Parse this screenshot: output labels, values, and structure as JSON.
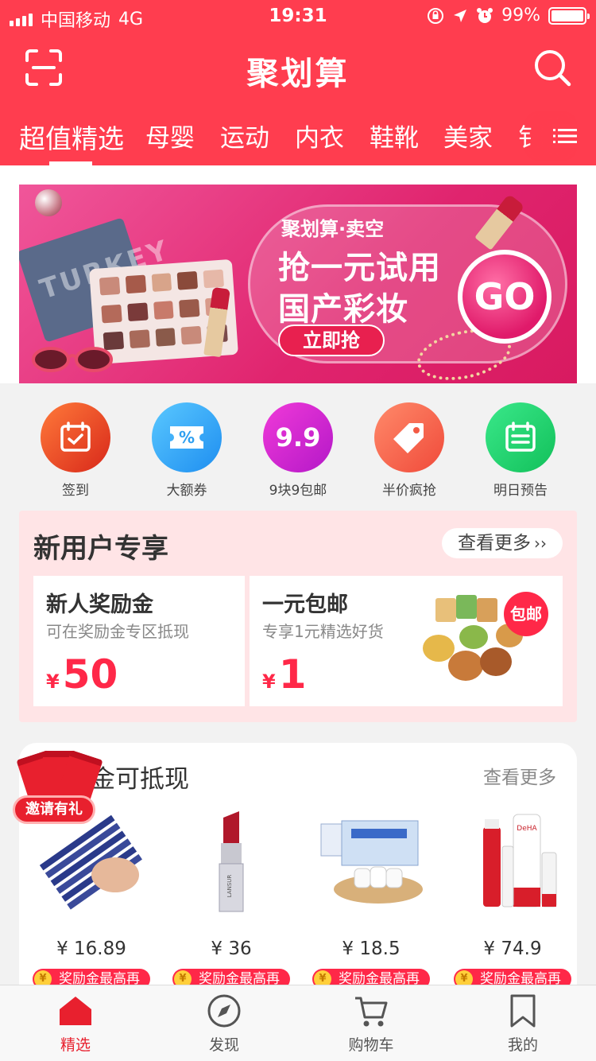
{
  "status_bar": {
    "carrier": "中国移动",
    "network": "4G",
    "time": "19:31",
    "battery": "99%",
    "battery_level": 0.99
  },
  "header": {
    "title": "聚划算",
    "tabs": [
      "超值精选",
      "母婴",
      "运动",
      "内衣",
      "鞋靴",
      "美家",
      "钅"
    ],
    "active_tab": 0,
    "accent": "#ff3d4f"
  },
  "banner": {
    "brand": "聚划算·卖空",
    "headline_line1": "抢一元试用",
    "headline_line2": "国产彩妆",
    "cta": "立即抢",
    "go": "GO",
    "box_text": "TURKEY"
  },
  "quick_entries": [
    {
      "label": "签到",
      "icon": "calendar-check-icon",
      "color": "#e8381f"
    },
    {
      "label": "大额券",
      "icon": "coupon-percent-icon",
      "color": "#2e9ff0"
    },
    {
      "label": "9块9包邮",
      "icon": "nine-nine-icon",
      "color": "#e01fb8",
      "text": "9.9"
    },
    {
      "label": "半价疯抢",
      "icon": "price-tag-icon",
      "color": "#ff6a55"
    },
    {
      "label": "明日预告",
      "icon": "calendar-list-icon",
      "color": "#22cc66"
    }
  ],
  "new_user": {
    "title": "新用户专享",
    "more": "查看更多",
    "cards": [
      {
        "title": "新人奖励金",
        "subtitle": "可在奖励金专区抵现",
        "currency": "¥",
        "amount": "50"
      },
      {
        "title": "一元包邮",
        "subtitle": "专享1元精选好货",
        "currency": "¥",
        "amount": "1",
        "badge": "包邮"
      }
    ]
  },
  "reward_goods": {
    "title": "金可抵现",
    "more": "查看更多",
    "invite_badge": "邀请有礼",
    "coin_text": "¥",
    "items": [
      {
        "image": "pencils-icon",
        "price": "¥ 16.89",
        "tag": "奖励金最高再"
      },
      {
        "image": "lipstick-icon",
        "price": "¥ 36",
        "tag": "奖励金最高再",
        "brand_text": "LANSUR"
      },
      {
        "image": "towels-icon",
        "price": "¥ 18.5",
        "tag": "奖励金最高再"
      },
      {
        "image": "skincare-set-icon",
        "price": "¥ 74.9",
        "tag": "奖励金最高再",
        "brand_text": "DeHA"
      }
    ]
  },
  "tabbar": {
    "items": [
      {
        "label": "精选",
        "icon": "home-icon",
        "active": true
      },
      {
        "label": "发现",
        "icon": "compass-icon",
        "active": false
      },
      {
        "label": "购物车",
        "icon": "cart-icon",
        "active": false
      },
      {
        "label": "我的",
        "icon": "bookmark-icon",
        "active": false
      }
    ],
    "active_color": "#e8202e"
  }
}
